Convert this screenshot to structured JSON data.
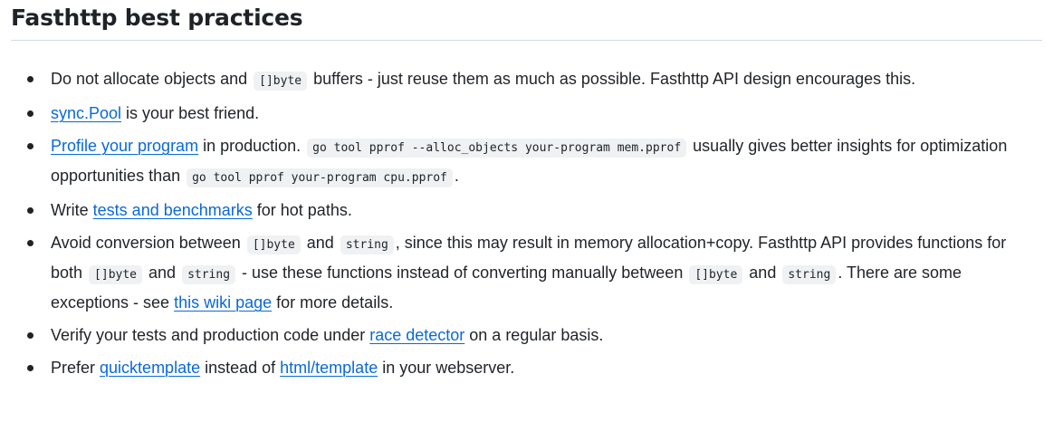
{
  "heading": "Fasthttp best practices",
  "items": [
    {
      "segments": [
        {
          "type": "text",
          "value": "Do not allocate objects and "
        },
        {
          "type": "code",
          "value": "[]byte"
        },
        {
          "type": "text",
          "value": " buffers - just reuse them as much as possible. Fasthttp API design encourages this."
        }
      ]
    },
    {
      "segments": [
        {
          "type": "link",
          "value": "sync.Pool"
        },
        {
          "type": "text",
          "value": " is your best friend."
        }
      ]
    },
    {
      "segments": [
        {
          "type": "link",
          "value": "Profile your program"
        },
        {
          "type": "text",
          "value": " in production. "
        },
        {
          "type": "code",
          "value": "go tool pprof --alloc_objects your-program mem.pprof"
        },
        {
          "type": "text",
          "value": " usually gives better insights for optimization opportunities than "
        },
        {
          "type": "code",
          "value": "go tool pprof your-program cpu.pprof"
        },
        {
          "type": "text",
          "value": "."
        }
      ]
    },
    {
      "segments": [
        {
          "type": "text",
          "value": "Write "
        },
        {
          "type": "link",
          "value": "tests and benchmarks"
        },
        {
          "type": "text",
          "value": " for hot paths."
        }
      ]
    },
    {
      "segments": [
        {
          "type": "text",
          "value": "Avoid conversion between "
        },
        {
          "type": "code",
          "value": "[]byte"
        },
        {
          "type": "text",
          "value": " and "
        },
        {
          "type": "code",
          "value": "string"
        },
        {
          "type": "text",
          "value": ", since this may result in memory allocation+copy. Fasthttp API provides functions for both "
        },
        {
          "type": "code",
          "value": "[]byte"
        },
        {
          "type": "text",
          "value": " and "
        },
        {
          "type": "code",
          "value": "string"
        },
        {
          "type": "text",
          "value": " - use these functions instead of converting manually between "
        },
        {
          "type": "code",
          "value": "[]byte"
        },
        {
          "type": "text",
          "value": " and "
        },
        {
          "type": "code",
          "value": "string"
        },
        {
          "type": "text",
          "value": ". There are some exceptions - see "
        },
        {
          "type": "link",
          "value": "this wiki page"
        },
        {
          "type": "text",
          "value": " for more details."
        }
      ]
    },
    {
      "segments": [
        {
          "type": "text",
          "value": "Verify your tests and production code under "
        },
        {
          "type": "link",
          "value": "race detector"
        },
        {
          "type": "text",
          "value": " on a regular basis."
        }
      ]
    },
    {
      "segments": [
        {
          "type": "text",
          "value": "Prefer "
        },
        {
          "type": "link",
          "value": "quicktemplate"
        },
        {
          "type": "text",
          "value": " instead of "
        },
        {
          "type": "link",
          "value": "html/template"
        },
        {
          "type": "text",
          "value": " in your webserver."
        }
      ]
    }
  ],
  "colors": {
    "text": "#1f2328",
    "link": "#0969da",
    "code_bg": "#eff1f3",
    "rule": "#d1d9e0"
  }
}
